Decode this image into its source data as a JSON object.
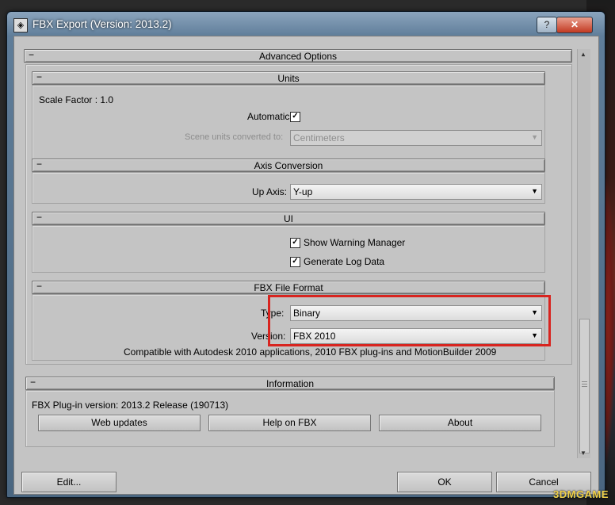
{
  "window": {
    "title": "FBX Export (Version: 2013.2)",
    "help_glyph": "?",
    "close_glyph": "✕",
    "app_icon": "3ds-max-app-icon"
  },
  "advanced": {
    "label": "Advanced Options",
    "toggle": "−"
  },
  "units": {
    "label": "Units",
    "scale_factor": "Scale Factor : 1.0",
    "automatic_label": "Automatic",
    "automatic_checked": true,
    "scene_units_label": "Scene units converted to:",
    "scene_units_value": "Centimeters"
  },
  "axis": {
    "label": "Axis Conversion",
    "up_axis_label": "Up Axis:",
    "up_axis_value": "Y-up"
  },
  "ui": {
    "label": "UI",
    "show_warning_label": "Show Warning Manager",
    "show_warning_checked": true,
    "generate_log_label": "Generate Log Data",
    "generate_log_checked": true
  },
  "fbx_format": {
    "label": "FBX File Format",
    "type_label": "Type:",
    "type_value": "Binary",
    "version_label": "Version:",
    "version_value": "FBX 2010",
    "compat_text": "Compatible with Autodesk 2010 applications, 2010 FBX plug-ins and MotionBuilder 2009",
    "highlight_color": "#d8241f"
  },
  "information": {
    "label": "Information",
    "plugin_version": "FBX Plug-in version: 2013.2 Release (190713)",
    "web_updates": "Web updates",
    "help_on_fbx": "Help on FBX",
    "about": "About"
  },
  "footer": {
    "edit": "Edit...",
    "ok": "OK",
    "cancel": "Cancel"
  },
  "checkmark": "✓",
  "arrow_down": "▼",
  "watermark": "3DMGAME"
}
